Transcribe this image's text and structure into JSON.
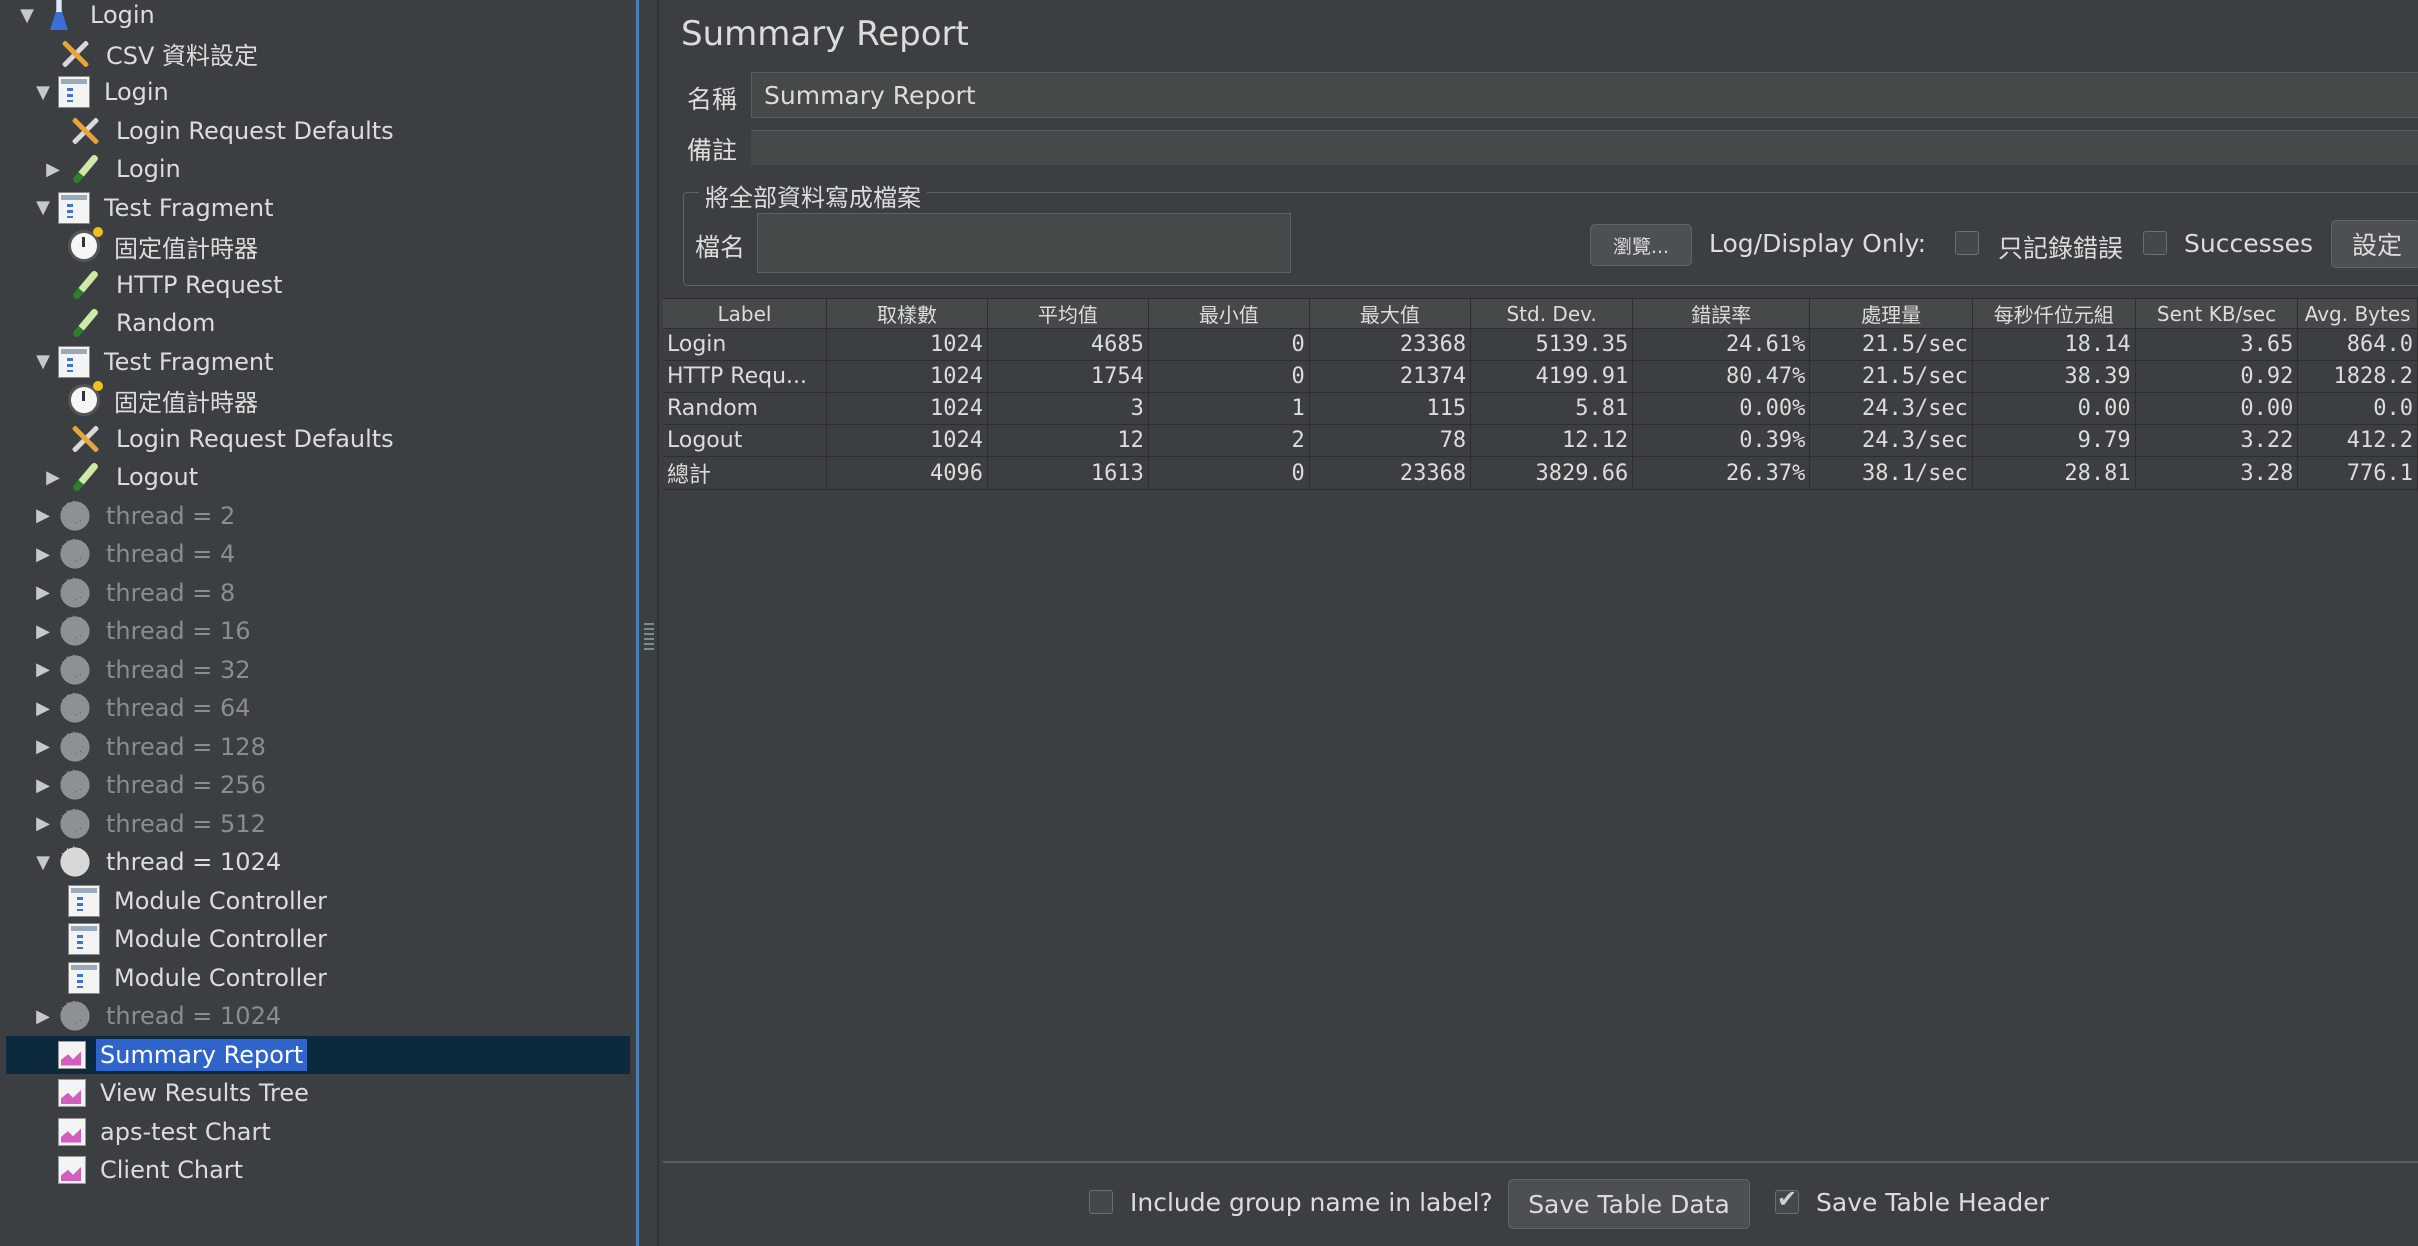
{
  "tree": {
    "items": [
      {
        "label": "Login",
        "icon": "flask-icon",
        "arrow": "▼"
      },
      {
        "label": "CSV 資料設定",
        "icon": "tools-icon",
        "arrow": ""
      },
      {
        "label": "Login",
        "icon": "controller-icon",
        "arrow": "▼"
      },
      {
        "label": "Login Request Defaults",
        "icon": "tools-icon",
        "arrow": ""
      },
      {
        "label": "Login",
        "icon": "sampler-pen-icon",
        "arrow": "▶"
      },
      {
        "label": "Test Fragment",
        "icon": "controller-icon",
        "arrow": "▼"
      },
      {
        "label": "固定值計時器",
        "icon": "timer-icon",
        "arrow": ""
      },
      {
        "label": "HTTP Request",
        "icon": "sampler-pen-icon",
        "arrow": ""
      },
      {
        "label": "Random",
        "icon": "sampler-pen-icon",
        "arrow": ""
      },
      {
        "label": "Test Fragment",
        "icon": "controller-icon",
        "arrow": "▼"
      },
      {
        "label": "固定值計時器",
        "icon": "timer-icon",
        "arrow": ""
      },
      {
        "label": "Login Request Defaults",
        "icon": "tools-icon",
        "arrow": ""
      },
      {
        "label": "Logout",
        "icon": "sampler-pen-icon",
        "arrow": "▶"
      },
      {
        "label": "thread = 2",
        "icon": "gear-icon",
        "arrow": "▶",
        "dim": true
      },
      {
        "label": "thread = 4",
        "icon": "gear-icon",
        "arrow": "▶",
        "dim": true
      },
      {
        "label": "thread = 8",
        "icon": "gear-icon",
        "arrow": "▶",
        "dim": true
      },
      {
        "label": "thread = 16",
        "icon": "gear-icon",
        "arrow": "▶",
        "dim": true
      },
      {
        "label": "thread = 32",
        "icon": "gear-icon",
        "arrow": "▶",
        "dim": true
      },
      {
        "label": "thread = 64",
        "icon": "gear-icon",
        "arrow": "▶",
        "dim": true
      },
      {
        "label": "thread = 128",
        "icon": "gear-icon",
        "arrow": "▶",
        "dim": true
      },
      {
        "label": "thread = 256",
        "icon": "gear-icon",
        "arrow": "▶",
        "dim": true
      },
      {
        "label": "thread = 512",
        "icon": "gear-icon",
        "arrow": "▶",
        "dim": true
      },
      {
        "label": "thread = 1024",
        "icon": "gear-active-icon",
        "arrow": "▼"
      },
      {
        "label": "Module Controller",
        "icon": "controller-icon",
        "arrow": ""
      },
      {
        "label": "Module Controller",
        "icon": "controller-icon",
        "arrow": ""
      },
      {
        "label": "Module Controller",
        "icon": "controller-icon",
        "arrow": ""
      },
      {
        "label": "thread = 1024",
        "icon": "gear-icon",
        "arrow": "▶",
        "dim": true
      },
      {
        "label": "Summary Report",
        "icon": "chart-icon",
        "arrow": "",
        "selected": true
      },
      {
        "label": "View Results Tree",
        "icon": "chart-icon",
        "arrow": ""
      },
      {
        "label": "aps-test Chart",
        "icon": "chart-icon",
        "arrow": ""
      },
      {
        "label": "Client Chart",
        "icon": "chart-icon",
        "arrow": ""
      }
    ]
  },
  "panel": {
    "title": "Summary Report",
    "name_label": "名稱",
    "name_value": "Summary Report",
    "comment_label": "備註",
    "fileset_legend": "將全部資料寫成檔案",
    "file_label": "檔名",
    "browse_label": "瀏覽...",
    "log_display_label": "Log/Display Only:",
    "errors_only_label": "只記錄錯誤",
    "successes_label": "Successes",
    "settings_label": "設定"
  },
  "table": {
    "headers": [
      "Label",
      "取樣數",
      "平均值",
      "最小值",
      "最大值",
      "Std. Dev.",
      "錯誤率",
      "處理量",
      "每秒仟位元組",
      "Sent KB/sec",
      "Avg. Bytes"
    ],
    "rows": [
      [
        "Login",
        "1024",
        "4685",
        "0",
        "23368",
        "5139.35",
        "24.61%",
        "21.5/sec",
        "18.14",
        "3.65",
        "864.0"
      ],
      [
        "HTTP Requ...",
        "1024",
        "1754",
        "0",
        "21374",
        "4199.91",
        "80.47%",
        "21.5/sec",
        "38.39",
        "0.92",
        "1828.2"
      ],
      [
        "Random",
        "1024",
        "3",
        "1",
        "115",
        "5.81",
        "0.00%",
        "24.3/sec",
        "0.00",
        "0.00",
        "0.0"
      ],
      [
        "Logout",
        "1024",
        "12",
        "2",
        "78",
        "12.12",
        "0.39%",
        "24.3/sec",
        "9.79",
        "3.22",
        "412.2"
      ],
      [
        "總計",
        "4096",
        "1613",
        "0",
        "23368",
        "3829.66",
        "26.37%",
        "38.1/sec",
        "28.81",
        "3.28",
        "776.1"
      ]
    ]
  },
  "footer": {
    "include_group_label": "Include group name in label?",
    "save_table_data_label": "Save Table Data",
    "save_table_header_label": "Save Table Header"
  }
}
